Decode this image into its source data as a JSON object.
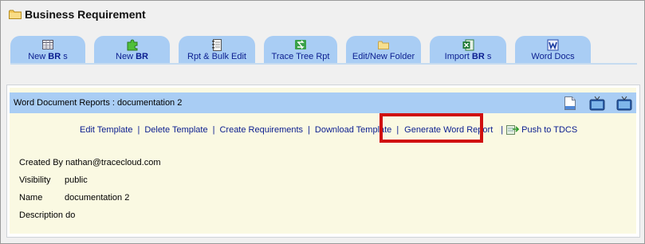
{
  "header": {
    "title": "Business Requirement",
    "icon": "folder-icon"
  },
  "tabs": [
    {
      "pre": "New ",
      "bold": "BR",
      "post": " s",
      "icon": "table-icon"
    },
    {
      "pre": "New ",
      "bold": "BR",
      "post": "",
      "icon": "puzzle-icon"
    },
    {
      "pre": "Rpt & Bulk Edit",
      "bold": "",
      "post": "",
      "icon": "notebook-icon"
    },
    {
      "pre": "Trace Tree Rpt",
      "bold": "",
      "post": "",
      "icon": "trace-tree-icon"
    },
    {
      "pre": "Edit/New Folder",
      "bold": "",
      "post": "",
      "icon": "folder-icon"
    },
    {
      "pre": "Import ",
      "bold": "BR",
      "post": " s",
      "icon": "excel-icon"
    },
    {
      "pre": "Word Docs",
      "bold": "",
      "post": "",
      "icon": "word-icon"
    }
  ],
  "panel": {
    "title": "Word Document Reports : documentation 2",
    "bar_icons": [
      "document-icon",
      "tv-icon",
      "tv-icon"
    ]
  },
  "actions": {
    "edit_template": "Edit Template",
    "delete_template": "Delete Template",
    "create_requirements": "Create Requirements",
    "download_template": "Download Template",
    "generate_word_report": "Generate Word Report",
    "push_to_tdcs": "Push to TDCS",
    "separator": "|"
  },
  "info": {
    "created_by_label": "Created By",
    "created_by_value": "nathan@tracecloud.com",
    "visibility_label": "Visibility",
    "visibility_value": "public",
    "name_label": "Name",
    "name_value": "documentation 2",
    "description_label": "Description",
    "description_value": "do"
  },
  "colors": {
    "tab_bg": "#a9cdf4",
    "link": "#0a1d8f",
    "panel_bg": "#faf9e2",
    "highlight": "#d01010"
  }
}
